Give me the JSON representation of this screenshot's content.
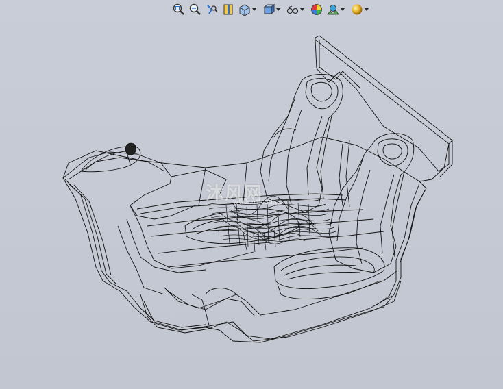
{
  "toolbar": {
    "buttons": [
      {
        "icon": "zoom-to-fit-icon",
        "dropdown": false
      },
      {
        "icon": "zoom-to-area-icon",
        "dropdown": false
      },
      {
        "icon": "previous-view-icon",
        "dropdown": false
      },
      {
        "icon": "section-view-icon",
        "dropdown": false
      },
      {
        "icon": "view-orientation-icon",
        "dropdown": true
      },
      {
        "icon": "display-style-icon",
        "dropdown": true
      },
      {
        "icon": "hide-show-items-icon",
        "dropdown": true
      },
      {
        "icon": "edit-appearance-icon",
        "dropdown": false
      },
      {
        "icon": "apply-scene-icon",
        "dropdown": true
      },
      {
        "icon": "view-settings-icon",
        "dropdown": true
      }
    ]
  },
  "watermark": {
    "logo_text": "沐风网",
    "url_text": "www.mfcad.com"
  },
  "colors": {
    "background": "#c4c8d2",
    "wireframe": "#111111"
  }
}
